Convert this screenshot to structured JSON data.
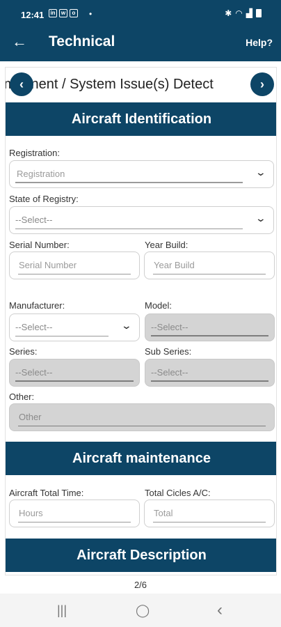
{
  "status_bar": {
    "time": "12:41",
    "notif_icons": [
      "in",
      "w",
      "o"
    ],
    "dot": "•"
  },
  "app_bar": {
    "back": "←",
    "title": "Technical",
    "help": "Help?"
  },
  "step": {
    "title": "Component / System Issue(s) Detect",
    "prev": "‹",
    "next": "›"
  },
  "sections": {
    "identification": "Aircraft Identification",
    "maintenance": "Aircraft maintenance",
    "description": "Aircraft Description"
  },
  "fields": {
    "registration": {
      "label": "Registration:",
      "placeholder": "Registration"
    },
    "state_of_registry": {
      "label": "State of Registry:",
      "value": "--Select--"
    },
    "serial_number": {
      "label": "Serial Number:",
      "placeholder": "Serial Number"
    },
    "year_build": {
      "label": "Year Build:",
      "placeholder": "Year Build"
    },
    "manufacturer": {
      "label": "Manufacturer:",
      "value": "--Select--"
    },
    "model": {
      "label": "Model:",
      "value": "--Select--"
    },
    "series": {
      "label": "Series:",
      "value": "--Select--"
    },
    "sub_series": {
      "label": "Sub Series:",
      "value": "--Select--"
    },
    "other": {
      "label": "Other:",
      "placeholder": "Other"
    },
    "total_time": {
      "label": "Aircraft Total Time:",
      "placeholder": "Hours"
    },
    "total_cycles": {
      "label": "Total Cicles A/C:",
      "placeholder": "Total"
    }
  },
  "pager": "2/6",
  "colors": {
    "primary": "#0d4566",
    "disabled": "#d4d4d4"
  },
  "system_nav": {
    "recents": "|||",
    "home": "◯",
    "back": "‹"
  }
}
